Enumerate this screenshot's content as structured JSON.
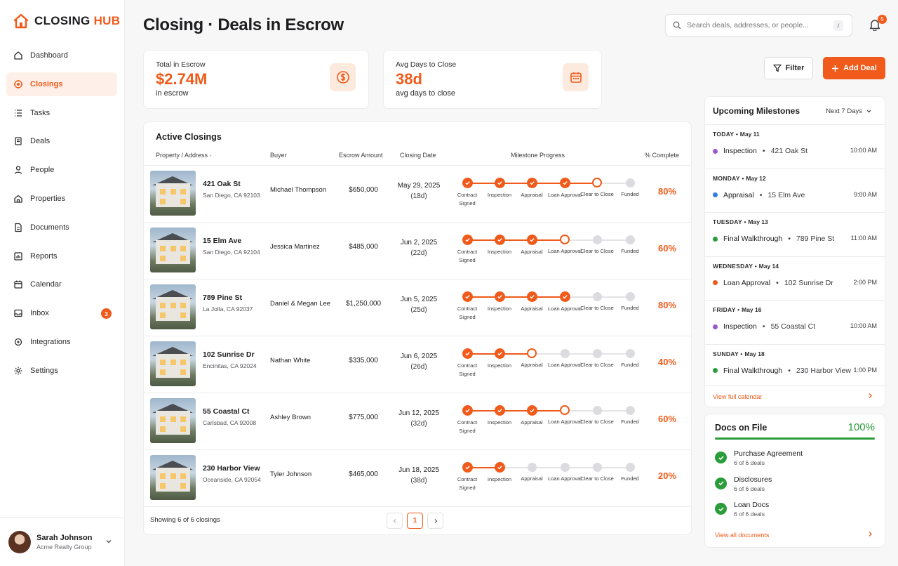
{
  "brand": {
    "name_part1": "CLOSING",
    "name_part2": "HUB",
    "accent": "#f05a1a"
  },
  "sidebar": {
    "items": [
      {
        "label": "Dashboard",
        "icon": "home-icon"
      },
      {
        "label": "Closings",
        "icon": "closings-icon",
        "active": true
      },
      {
        "label": "Tasks",
        "icon": "tasks-icon"
      },
      {
        "label": "Deals",
        "icon": "deals-icon"
      },
      {
        "label": "People",
        "icon": "person-icon"
      },
      {
        "label": "Properties",
        "icon": "properties-icon"
      },
      {
        "label": "Documents",
        "icon": "document-icon"
      },
      {
        "label": "Reports",
        "icon": "reports-icon"
      },
      {
        "label": "Calendar",
        "icon": "calendar-icon"
      },
      {
        "label": "Inbox",
        "icon": "inbox-icon",
        "badge": "3"
      },
      {
        "label": "Integrations",
        "icon": "integrations-icon"
      },
      {
        "label": "Settings",
        "icon": "gear-icon"
      }
    ],
    "user": {
      "name": "Sarah Johnson",
      "org": "Acme Realty Group"
    }
  },
  "header": {
    "title": "Closing · Deals in Escrow",
    "search_placeholder": "Search deals, addresses, or people...",
    "search_shortcut": "/",
    "notifications": "5"
  },
  "stats": [
    {
      "label": "Total in Escrow",
      "value": "$2.74M",
      "sub": "in escrow",
      "icon": "dollar-icon"
    },
    {
      "label": "Avg Days to Close",
      "value": "38d",
      "sub": "avg days to close",
      "icon": "calendar-icon"
    }
  ],
  "actions": {
    "filter_label": "Filter",
    "add_label": "Add Deal"
  },
  "closings": {
    "title": "Active Closings",
    "columns": [
      "Property / Address ·",
      "Buyer",
      "Escrow Amount",
      "Closing Date",
      "Milestone Progress",
      "% Complete"
    ],
    "milestones": [
      "Contract Signed",
      "Inspection",
      "Appraisal",
      "Loan Approval",
      "Clear to Close",
      "Funded"
    ],
    "rows": [
      {
        "address": "421 Oak St",
        "city": "San Diego, CA 92103",
        "buyer": "Michael Thompson",
        "amount": "$650,000",
        "date": "May 29, 2025",
        "days": "(18d)",
        "done": 4,
        "current": 4,
        "pct": "80%"
      },
      {
        "address": "15 Elm Ave",
        "city": "San Diego, CA 92104",
        "buyer": "Jessica Martinez",
        "amount": "$485,000",
        "date": "Jun 2, 2025",
        "days": "(22d)",
        "done": 3,
        "current": 3,
        "pct": "60%"
      },
      {
        "address": "789 Pine St",
        "city": "La Jolla, CA 92037",
        "buyer": "Daniel & Megan Lee",
        "amount": "$1,250,000",
        "date": "Jun 5, 2025",
        "days": "(25d)",
        "done": 4,
        "current": -1,
        "pct": "80%"
      },
      {
        "address": "102 Sunrise Dr",
        "city": "Encinitas, CA 92024",
        "buyer": "Nathan White",
        "amount": "$335,000",
        "date": "Jun 6, 2025",
        "days": "(26d)",
        "done": 2,
        "current": 2,
        "pct": "40%"
      },
      {
        "address": "55 Coastal Ct",
        "city": "Carlsbad, CA 92008",
        "buyer": "Ashley Brown",
        "amount": "$775,000",
        "date": "Jun 12, 2025",
        "days": "(32d)",
        "done": 3,
        "current": 3,
        "pct": "60%"
      },
      {
        "address": "230 Harbor View",
        "city": "Oceanside, CA 92054",
        "buyer": "Tyler Johnson",
        "amount": "$465,000",
        "date": "Jun 18, 2025",
        "days": "(38d)",
        "done": 2,
        "current": -1,
        "pct": "20%"
      }
    ],
    "showing": "Showing 6 of 6 closings",
    "page": "1"
  },
  "milestones_panel": {
    "title": "Upcoming Milestones",
    "range": "Next 7 Days",
    "days": [
      {
        "day": "TODAY",
        "date": "May 11",
        "event": "Inspection",
        "place": "421 Oak St",
        "time": "10:00 AM",
        "color": "#9b59c9"
      },
      {
        "day": "MONDAY",
        "date": "May 12",
        "event": "Appraisal",
        "place": "15 Elm Ave",
        "time": "9:00 AM",
        "color": "#2f7fe0"
      },
      {
        "day": "TUESDAY",
        "date": "May 13",
        "event": "Final Walkthrough",
        "place": "789 Pine St",
        "time": "11:00 AM",
        "color": "#2a9d3a"
      },
      {
        "day": "WEDNESDAY",
        "date": "May 14",
        "event": "Loan Approval",
        "place": "102 Sunrise Dr",
        "time": "2:00 PM",
        "color": "#f05a1a"
      },
      {
        "day": "FRIDAY",
        "date": "May 16",
        "event": "Inspection",
        "place": "55 Coastal Ct",
        "time": "10:00 AM",
        "color": "#9b59c9"
      },
      {
        "day": "SUNDAY",
        "date": "May 18",
        "event": "Final Walkthrough",
        "place": "230 Harbor View",
        "time": "1:00 PM",
        "color": "#2a9d3a"
      }
    ],
    "view_all": "View full calendar"
  },
  "docs_panel": {
    "title": "Docs on File",
    "pct": "100%",
    "items": [
      {
        "name": "Purchase Agreement",
        "sub": "6 of 6 deals"
      },
      {
        "name": "Disclosures",
        "sub": "6 of 6 deals"
      },
      {
        "name": "Loan Docs",
        "sub": "6 of 6 deals"
      }
    ],
    "view_all": "View all documents"
  }
}
